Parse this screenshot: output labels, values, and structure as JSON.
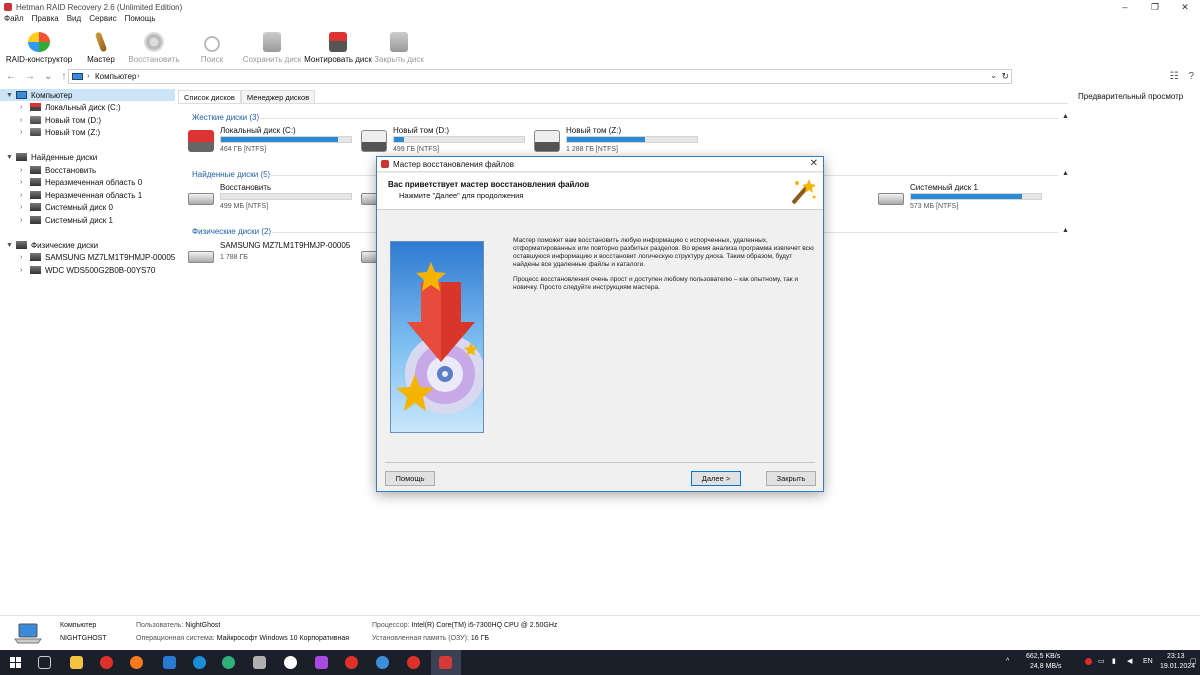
{
  "window": {
    "title": "Hetman RAID Recovery 2.6 (Unlimited Edition)",
    "controls": [
      "–",
      "❐",
      "✕"
    ]
  },
  "menu": [
    "Файл",
    "Правка",
    "Вид",
    "Сервис",
    "Помощь"
  ],
  "toolbar": [
    {
      "label": "RAID-конструктор",
      "icon": "raid-icon",
      "enabled": true
    },
    {
      "label": "Мастер",
      "icon": "wizard-icon",
      "enabled": true
    },
    {
      "label": "Восстановить",
      "icon": "restore-icon",
      "enabled": false
    },
    {
      "label": "Поиск",
      "icon": "search-icon",
      "enabled": false
    },
    {
      "label": "Сохранить диск",
      "icon": "save-disk-icon",
      "enabled": false
    },
    {
      "label": "Монтировать диск",
      "icon": "mount-disk-icon",
      "enabled": true
    },
    {
      "label": "Закрыть диск",
      "icon": "close-disk-icon",
      "enabled": false
    }
  ],
  "address": {
    "path": "Компьютер",
    "sep": "›"
  },
  "tree": {
    "computer": "Компьютер",
    "computer_children": [
      "Локальный диск (C:)",
      "Новый том (D:)",
      "Новый том (Z:)"
    ],
    "found": "Найденные диски",
    "found_children": [
      "Восстановить",
      "Неразмеченная область 0",
      "Неразмеченная область 1",
      "Системный диск 0",
      "Системный диск 1"
    ],
    "physical": "Физические диски",
    "physical_children": [
      "SAMSUNG MZ7LM1T9HMJP-00005",
      "WDC WDS500G2B0B-00YS70"
    ]
  },
  "tabs": [
    "Список дисков",
    "Менеджер дисков"
  ],
  "preview_label": "Предварительный просмотр",
  "sections": {
    "hard": "Жесткие диски (3)",
    "found": "Найденные диски (5)",
    "physical": "Физические диски (2)"
  },
  "hard_disks": [
    {
      "name": "Локальный диск (C:)",
      "size": "464 ГБ [NTFS]",
      "used": 0.9,
      "icon": "red"
    },
    {
      "name": "Новый том (D:)",
      "size": "499 ГБ [NTFS]",
      "used": 0.08,
      "icon": "usb"
    },
    {
      "name": "Новый том (Z:)",
      "size": "1 288 ГБ [NTFS]",
      "used": 0.6,
      "icon": "usb"
    }
  ],
  "found_disks": [
    {
      "name": "Восстановить",
      "size": "499 МБ [NTFS]",
      "used": 0.0
    },
    {
      "name": "Системный диск 1",
      "size": "573 МБ [NTFS]",
      "used": 0.85
    }
  ],
  "physical_disks": [
    {
      "name": "SAMSUNG MZ7LM1T9HMJP-00005",
      "size": "1 788 ГБ"
    }
  ],
  "dialog": {
    "title": "Мастер восстановления файлов",
    "heading": "Вас приветствует мастер восстановления файлов",
    "subheading": "Нажмите \"Далее\" для продолжения",
    "para1": "Мастер поможет вам восстановить любую информацию с испорченных, удаленных, отформатированных или повторно разбитых разделов. Во время анализа программа извлечет всю оставшуюся информацию и восстановит логическую структуру диска. Таким образом, будут найдены все удаленные файлы и каталоги.",
    "para2": "Процесс восстановления очень прост и доступен любому пользователю – как опытному, так и новичку. Просто следуйте инструкциям мастера.",
    "help_button": "Помощь",
    "next_button": "Далее >",
    "close_button": "Закрыть"
  },
  "status": {
    "computer_label": "Компьютер",
    "computer_name": "NIGHTGHOST",
    "user_key": "Пользователь:",
    "user_val": "NightGhost",
    "os_key": "Операционная система:",
    "os_val": "Майкрософт Windows 10 Корпоративная",
    "cpu_key": "Процессор:",
    "cpu_val": "Intel(R) Core(TM) i5-7300HQ CPU @ 2.50GHz",
    "ram_key": "Установленная память (ОЗУ):",
    "ram_val": "16 ГБ"
  },
  "taskbar": {
    "net_up": "662,5 KB/s",
    "net_down": "24,8 MB/s",
    "lang": "EN",
    "time": "23:13",
    "date": "19.01.2024"
  }
}
